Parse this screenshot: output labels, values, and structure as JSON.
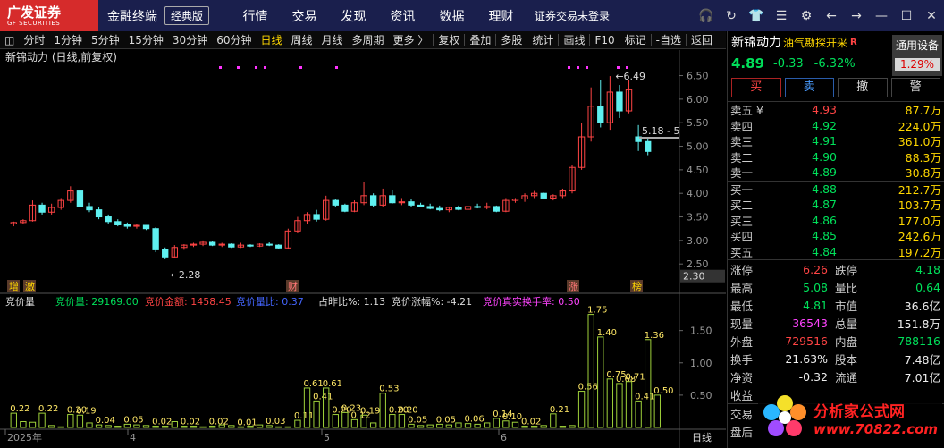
{
  "titlebar": {
    "logo": "广发证券",
    "logo_sub": "GF SECURITIES",
    "app_name": "金融终端",
    "edition": "经典版",
    "menu": [
      "行情",
      "交易",
      "发现",
      "资讯",
      "数据",
      "理财"
    ],
    "login_status": "证券交易未登录"
  },
  "toolbar": {
    "items": [
      "分时",
      "1分钟",
      "5分钟",
      "15分钟",
      "30分钟",
      "60分钟",
      "日线",
      "周线",
      "月线",
      "多周期",
      "更多 〉"
    ],
    "active": "日线",
    "right_items": [
      "复权",
      "叠加",
      "多股",
      "统计",
      "画线",
      "F10",
      "标记",
      "-自选",
      "返回"
    ]
  },
  "chart": {
    "header": "新锦动力 (日线,前复权)",
    "y_ticks": [
      "6.50",
      "6.00",
      "5.50",
      "5.00",
      "4.50",
      "4.00",
      "3.50",
      "3.00",
      "2.50"
    ],
    "current_price_label": "2.30",
    "annotations": {
      "high": "6.49",
      "low": "2.28",
      "last": "5.18 - 5"
    },
    "event_markers": [
      "增",
      "激",
      "财",
      "涨",
      "榜"
    ],
    "indicator": {
      "name": "竞价量",
      "items": [
        {
          "label": "竞价量: 29169.00",
          "color": "#00e05a"
        },
        {
          "label": "竞价金额: 1458.45",
          "color": "#ff4444"
        },
        {
          "label": "竞价量比: 0.37",
          "color": "#4466ff"
        },
        {
          "label": "占昨比%: 1.13",
          "color": "#dddddd"
        },
        {
          "label": "竞价涨幅%: -4.21",
          "color": "#dddddd"
        },
        {
          "label": "竞价真实换手率: 0.50",
          "color": "#ff44ff"
        }
      ],
      "y_ticks": [
        "1.50",
        "1.00",
        "0.50"
      ]
    },
    "x_labels": [
      "2025年",
      "4",
      "5",
      "6"
    ],
    "period_label": "日线"
  },
  "chart_data": {
    "type": "candlestick",
    "title": "新锦动力 (日线,前复权)",
    "ylim": [
      2.2,
      6.7
    ],
    "candles": [
      [
        3.35,
        3.4,
        3.3,
        3.38
      ],
      [
        3.38,
        3.45,
        3.35,
        3.42
      ],
      [
        3.42,
        3.85,
        3.4,
        3.75
      ],
      [
        3.75,
        3.8,
        3.55,
        3.6
      ],
      [
        3.6,
        3.78,
        3.55,
        3.7
      ],
      [
        3.7,
        3.9,
        3.65,
        3.85
      ],
      [
        3.85,
        4.15,
        3.8,
        4.05
      ],
      [
        4.05,
        4.05,
        3.7,
        3.72
      ],
      [
        3.72,
        3.8,
        3.6,
        3.65
      ],
      [
        3.65,
        3.7,
        3.45,
        3.5
      ],
      [
        3.5,
        3.55,
        3.35,
        3.4
      ],
      [
        3.4,
        3.45,
        3.3,
        3.33
      ],
      [
        3.33,
        3.38,
        3.25,
        3.3
      ],
      [
        3.3,
        3.35,
        3.25,
        3.32
      ],
      [
        3.32,
        3.33,
        3.22,
        3.25
      ],
      [
        3.25,
        3.28,
        2.75,
        2.8
      ],
      [
        2.8,
        2.85,
        2.6,
        2.65
      ],
      [
        2.65,
        2.9,
        2.62,
        2.85
      ],
      [
        2.85,
        2.92,
        2.8,
        2.9
      ],
      [
        2.9,
        2.95,
        2.86,
        2.92
      ],
      [
        2.92,
        3.0,
        2.88,
        2.96
      ],
      [
        2.96,
        2.98,
        2.88,
        2.9
      ],
      [
        2.9,
        2.95,
        2.86,
        2.92
      ],
      [
        2.92,
        2.94,
        2.84,
        2.86
      ],
      [
        2.86,
        2.95,
        2.84,
        2.9
      ],
      [
        2.9,
        2.92,
        2.86,
        2.88
      ],
      [
        2.88,
        2.94,
        2.86,
        2.92
      ],
      [
        2.92,
        2.96,
        2.88,
        2.9
      ],
      [
        2.9,
        2.92,
        2.82,
        2.84
      ],
      [
        2.84,
        3.25,
        2.82,
        3.2
      ],
      [
        3.2,
        3.5,
        3.15,
        3.42
      ],
      [
        3.42,
        3.6,
        3.35,
        3.55
      ],
      [
        3.55,
        3.65,
        3.4,
        3.45
      ],
      [
        3.45,
        3.95,
        3.42,
        3.85
      ],
      [
        3.85,
        3.88,
        3.7,
        3.75
      ],
      [
        3.75,
        3.78,
        3.6,
        3.62
      ],
      [
        3.62,
        3.85,
        3.6,
        3.8
      ],
      [
        3.8,
        4.25,
        3.75,
        3.95
      ],
      [
        3.95,
        4.0,
        3.7,
        3.75
      ],
      [
        3.75,
        4.1,
        3.72,
        3.95
      ],
      [
        3.95,
        4.08,
        3.78,
        3.8
      ],
      [
        3.8,
        3.9,
        3.75,
        3.82
      ],
      [
        3.82,
        3.88,
        3.72,
        3.75
      ],
      [
        3.75,
        3.8,
        3.7,
        3.72
      ],
      [
        3.72,
        3.78,
        3.66,
        3.68
      ],
      [
        3.68,
        3.74,
        3.62,
        3.65
      ],
      [
        3.65,
        3.72,
        3.6,
        3.7
      ],
      [
        3.7,
        3.74,
        3.64,
        3.66
      ],
      [
        3.66,
        3.74,
        3.64,
        3.72
      ],
      [
        3.72,
        3.78,
        3.68,
        3.7
      ],
      [
        3.7,
        3.8,
        3.66,
        3.72
      ],
      [
        3.72,
        3.74,
        3.6,
        3.62
      ],
      [
        3.62,
        3.9,
        3.6,
        3.85
      ],
      [
        3.85,
        3.9,
        3.8,
        3.88
      ],
      [
        3.88,
        4.0,
        3.82,
        3.95
      ],
      [
        3.95,
        4.05,
        3.9,
        4.0
      ],
      [
        4.0,
        4.02,
        3.88,
        3.9
      ],
      [
        3.9,
        3.98,
        3.85,
        3.95
      ],
      [
        3.95,
        4.1,
        3.9,
        4.05
      ],
      [
        4.05,
        4.6,
        4.0,
        4.55
      ],
      [
        4.55,
        5.5,
        4.5,
        5.2
      ],
      [
        5.2,
        6.25,
        5.1,
        5.85
      ],
      [
        5.85,
        6.4,
        5.4,
        5.5
      ],
      [
        5.5,
        6.49,
        5.35,
        6.15
      ],
      [
        6.15,
        6.3,
        5.6,
        5.75
      ],
      [
        5.75,
        6.4,
        5.7,
        6.2
      ],
      [
        5.2,
        5.45,
        4.9,
        5.1
      ],
      [
        5.1,
        5.15,
        4.81,
        4.89
      ]
    ],
    "indicator_series": {
      "name": "竞价量",
      "values": [
        0.22,
        0.09,
        0.08,
        0.22,
        0.03,
        0.01,
        0.2,
        0.19,
        0.07,
        0.04,
        0.03,
        0.02,
        0.05,
        0.04,
        0.03,
        0.02,
        0.02,
        0.09,
        0.02,
        0.02,
        0.01,
        0.02,
        0.04,
        0.03,
        0.01,
        0.02,
        0.04,
        0.03,
        0.01,
        0.01,
        0.11,
        0.61,
        0.41,
        0.61,
        0.2,
        0.23,
        0.12,
        0.19,
        0.07,
        0.53,
        0.2,
        0.2,
        0.05,
        0.03,
        0.04,
        0.05,
        0.04,
        0.07,
        0.06,
        0.05,
        0.07,
        0.14,
        0.1,
        0.08,
        0.02,
        0.02,
        0.03,
        0.21,
        0.02,
        0.03,
        0.56,
        1.75,
        1.4,
        0.75,
        0.68,
        0.71,
        0.41,
        1.36,
        0.5
      ],
      "ylim": [
        0,
        1.8
      ]
    }
  },
  "quote": {
    "name": "新锦动力",
    "tag": "油气勘探开采",
    "mark": "R",
    "settings_label": "通用设备",
    "settings_pct": "1.29%",
    "price": "4.89",
    "change": "-0.33",
    "change_pct": "-6.32%",
    "buttons": [
      "买",
      "卖",
      "撤",
      "警"
    ],
    "asks": [
      {
        "label": "卖五 ¥",
        "price": "4.93",
        "vol": "87.7万",
        "color": "#ff4444"
      },
      {
        "label": "卖四",
        "price": "4.92",
        "vol": "224.0万",
        "color": "#00e05a"
      },
      {
        "label": "卖三",
        "price": "4.91",
        "vol": "361.0万",
        "color": "#00e05a"
      },
      {
        "label": "卖二",
        "price": "4.90",
        "vol": "88.3万",
        "color": "#00e05a"
      },
      {
        "label": "卖一",
        "price": "4.89",
        "vol": "30.8万",
        "color": "#00e05a"
      }
    ],
    "bids": [
      {
        "label": "买一",
        "price": "4.88",
        "vol": "212.7万",
        "color": "#00e05a"
      },
      {
        "label": "买二",
        "price": "4.87",
        "vol": "103.7万",
        "color": "#00e05a"
      },
      {
        "label": "买三",
        "price": "4.86",
        "vol": "177.0万",
        "color": "#00e05a"
      },
      {
        "label": "买四",
        "price": "4.85",
        "vol": "242.6万",
        "color": "#00e05a"
      },
      {
        "label": "买五",
        "price": "4.84",
        "vol": "197.2万",
        "color": "#00e05a"
      }
    ],
    "stats": [
      {
        "k": "涨停",
        "v": "6.26",
        "vc": "#ff4444",
        "k2": "跌停",
        "v2": "4.18",
        "v2c": "#00e05a"
      },
      {
        "k": "最高",
        "v": "5.08",
        "vc": "#00e05a",
        "k2": "量比",
        "v2": "0.64",
        "v2c": "#00e05a"
      },
      {
        "k": "最低",
        "v": "4.81",
        "vc": "#00e05a",
        "k2": "市值",
        "v2": "36.6亿",
        "v2c": "#eeeeee"
      },
      {
        "k": "现量",
        "v": "36543",
        "vc": "#ff44ff",
        "k2": "总量",
        "v2": "151.8万",
        "v2c": "#eeeeee"
      },
      {
        "k": "外盘",
        "v": "729516",
        "vc": "#ff4444",
        "k2": "内盘",
        "v2": "788116",
        "v2c": "#00e05a"
      },
      {
        "k": "换手",
        "v": "21.63%",
        "vc": "#eeeeee",
        "k2": "股本",
        "v2": "7.48亿",
        "v2c": "#eeeeee"
      },
      {
        "k": "净资",
        "v": "-0.32",
        "vc": "#eeeeee",
        "k2": "流通",
        "v2": "7.01亿",
        "v2c": "#eeeeee"
      },
      {
        "k": "收益",
        "v": "",
        "vc": "#eeeeee",
        "k2": "",
        "v2": "",
        "v2c": "#eeeeee"
      }
    ],
    "footer_labels": [
      "交易",
      "盘后"
    ]
  },
  "watermark": {
    "line1": "分析家公式网",
    "line2": "www.70822.com"
  },
  "colors": {
    "up": "#ff4444",
    "down": "#5ff0f0",
    "bg": "#000000",
    "titlebar": "#1a1f4d",
    "accent": "#ffd700"
  }
}
